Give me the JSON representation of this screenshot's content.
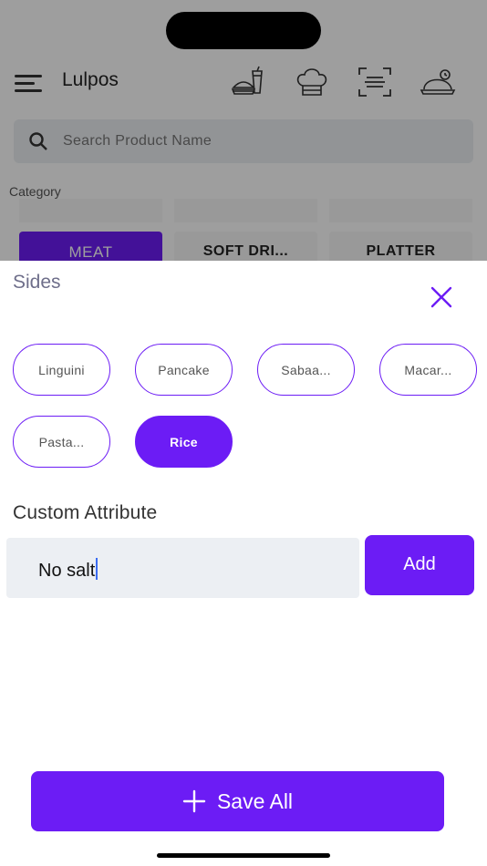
{
  "app": {
    "title": "Lulpos",
    "header_icons": [
      "food-drink-icon",
      "chef-hat-icon",
      "scan-icon",
      "serving-cloche-icon"
    ]
  },
  "search": {
    "placeholder": "Search Product Name",
    "value": ""
  },
  "category": {
    "label": "Category",
    "items": [
      {
        "label": "MEAT",
        "active": true
      },
      {
        "label": "SOFT DRI...",
        "active": false
      },
      {
        "label": "PLATTER",
        "active": false
      }
    ]
  },
  "sheet": {
    "title": "Sides",
    "options": [
      {
        "label": "Linguini",
        "selected": false
      },
      {
        "label": "Pancake",
        "selected": false
      },
      {
        "label": "Sabaa...",
        "selected": false
      },
      {
        "label": "Macar...",
        "selected": false
      },
      {
        "label": "Pasta...",
        "selected": false
      },
      {
        "label": "Rice",
        "selected": true
      }
    ],
    "custom_attribute": {
      "label": "Custom Attribute",
      "value": "No salt",
      "add_label": "Add"
    },
    "save_label": "Save All"
  },
  "colors": {
    "accent": "#6c1cf5",
    "input_bg": "#eceff3",
    "title_muted": "#6e6e8a"
  }
}
